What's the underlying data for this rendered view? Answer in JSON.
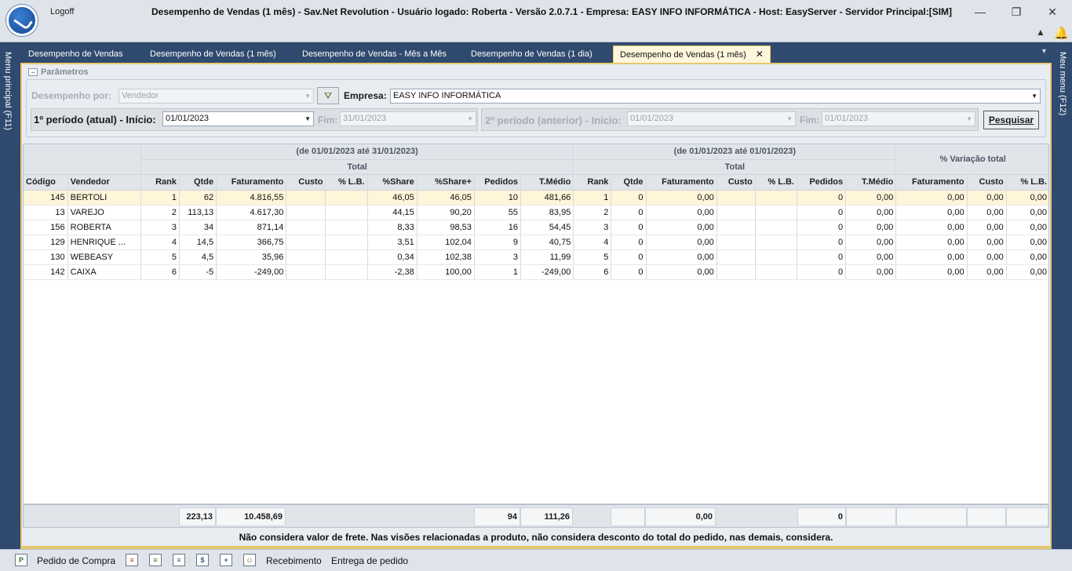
{
  "window": {
    "logoff_label": "Logoff",
    "title": "Desempenho de Vendas (1 mês) - Sav.Net Revolution - Usuário logado: Roberta - Versão 2.0.7.1 - Empresa: EASY INFO INFORMÁTICA - Host: EasyServer - Servidor Principal:[SIM]",
    "min_glyph": "—",
    "max_glyph": "❐",
    "close_glyph": "✕"
  },
  "side": {
    "left_label": "Menu principal (F11)",
    "right_label": "Meu menu (F12)"
  },
  "tabs": [
    {
      "label": "Desempenho de Vendas"
    },
    {
      "label": "Desempenho de Vendas (1 mês)"
    },
    {
      "label": "Desempenho de Vendas - Mês a Mês"
    },
    {
      "label": "Desempenho de Vendas (1 dia)"
    },
    {
      "label": "Desempenho de Vendas (1 mês)",
      "close": "✕"
    }
  ],
  "params": {
    "legend": "Parâmetros",
    "desempenho_label": "Desempenho por:",
    "desempenho_value": "Vendedor",
    "empresa_label": "Empresa:",
    "empresa_value": "EASY INFO INFORMÁTICA",
    "p1_label": "1º período (atual) - Início:",
    "p1_inicio": "01/01/2023",
    "fim_label": "Fim:",
    "p1_fim": "31/01/2023",
    "p2_label": "2º período (anterior) - Início:",
    "p2_inicio": "01/01/2023",
    "p2_fim": "01/01/2023",
    "search_label": "Pesquisar"
  },
  "grid": {
    "header1": {
      "p1": "(de 01/01/2023 até 31/01/2023)",
      "p2": "(de 01/01/2023 até 01/01/2023)",
      "var": "% Variação total"
    },
    "header2": {
      "p1": "Total",
      "p2": "Total"
    },
    "columns": [
      "Código",
      "Vendedor",
      "Rank",
      "Qtde",
      "Faturamento",
      "Custo",
      "% L.B.",
      "%Share",
      "%Share+",
      "Pedidos",
      "T.Médio",
      "Rank",
      "Qtde",
      "Faturamento",
      "Custo",
      "% L.B.",
      "Pedidos",
      "T.Médio",
      "Faturamento",
      "Custo",
      "% L.B."
    ],
    "rows": [
      [
        "145",
        "BERTOLI",
        "1",
        "62",
        "4.816,55",
        "",
        "",
        "46,05",
        "46,05",
        "10",
        "481,66",
        "1",
        "0",
        "0,00",
        "",
        "",
        "0",
        "0,00",
        "0,00",
        "0,00",
        "0,00"
      ],
      [
        "13",
        "VAREJO",
        "2",
        "113,13",
        "4.617,30",
        "",
        "",
        "44,15",
        "90,20",
        "55",
        "83,95",
        "2",
        "0",
        "0,00",
        "",
        "",
        "0",
        "0,00",
        "0,00",
        "0,00",
        "0,00"
      ],
      [
        "156",
        "ROBERTA",
        "3",
        "34",
        "871,14",
        "",
        "",
        "8,33",
        "98,53",
        "16",
        "54,45",
        "3",
        "0",
        "0,00",
        "",
        "",
        "0",
        "0,00",
        "0,00",
        "0,00",
        "0,00"
      ],
      [
        "129",
        "HENRIQUE        ...",
        "4",
        "14,5",
        "366,75",
        "",
        "",
        "3,51",
        "102,04",
        "9",
        "40,75",
        "4",
        "0",
        "0,00",
        "",
        "",
        "0",
        "0,00",
        "0,00",
        "0,00",
        "0,00"
      ],
      [
        "130",
        "WEBEASY",
        "5",
        "4,5",
        "35,96",
        "",
        "",
        "0,34",
        "102,38",
        "3",
        "11,99",
        "5",
        "0",
        "0,00",
        "",
        "",
        "0",
        "0,00",
        "0,00",
        "0,00",
        "0,00"
      ],
      [
        "142",
        "CAIXA",
        "6",
        "-5",
        "-249,00",
        "",
        "",
        "-2,38",
        "100,00",
        "1",
        "-249,00",
        "6",
        "0",
        "0,00",
        "",
        "",
        "0",
        "0,00",
        "0,00",
        "0,00",
        "0,00"
      ]
    ]
  },
  "totals": {
    "qtde": "223,13",
    "faturamento": "10.458,69",
    "pedidos": "94",
    "tmedio": "111,26",
    "p2_faturamento": "0,00",
    "p2_pedidos": "0"
  },
  "note": "Não considera valor de frete. Nas visões relacionadas a produto, não considera desconto do total do pedido, nas demais, considera.",
  "bottombar": {
    "pedido_compra": "Pedido de Compra",
    "recebimento": "Recebimento",
    "entrega": "Entrega de pedido"
  }
}
